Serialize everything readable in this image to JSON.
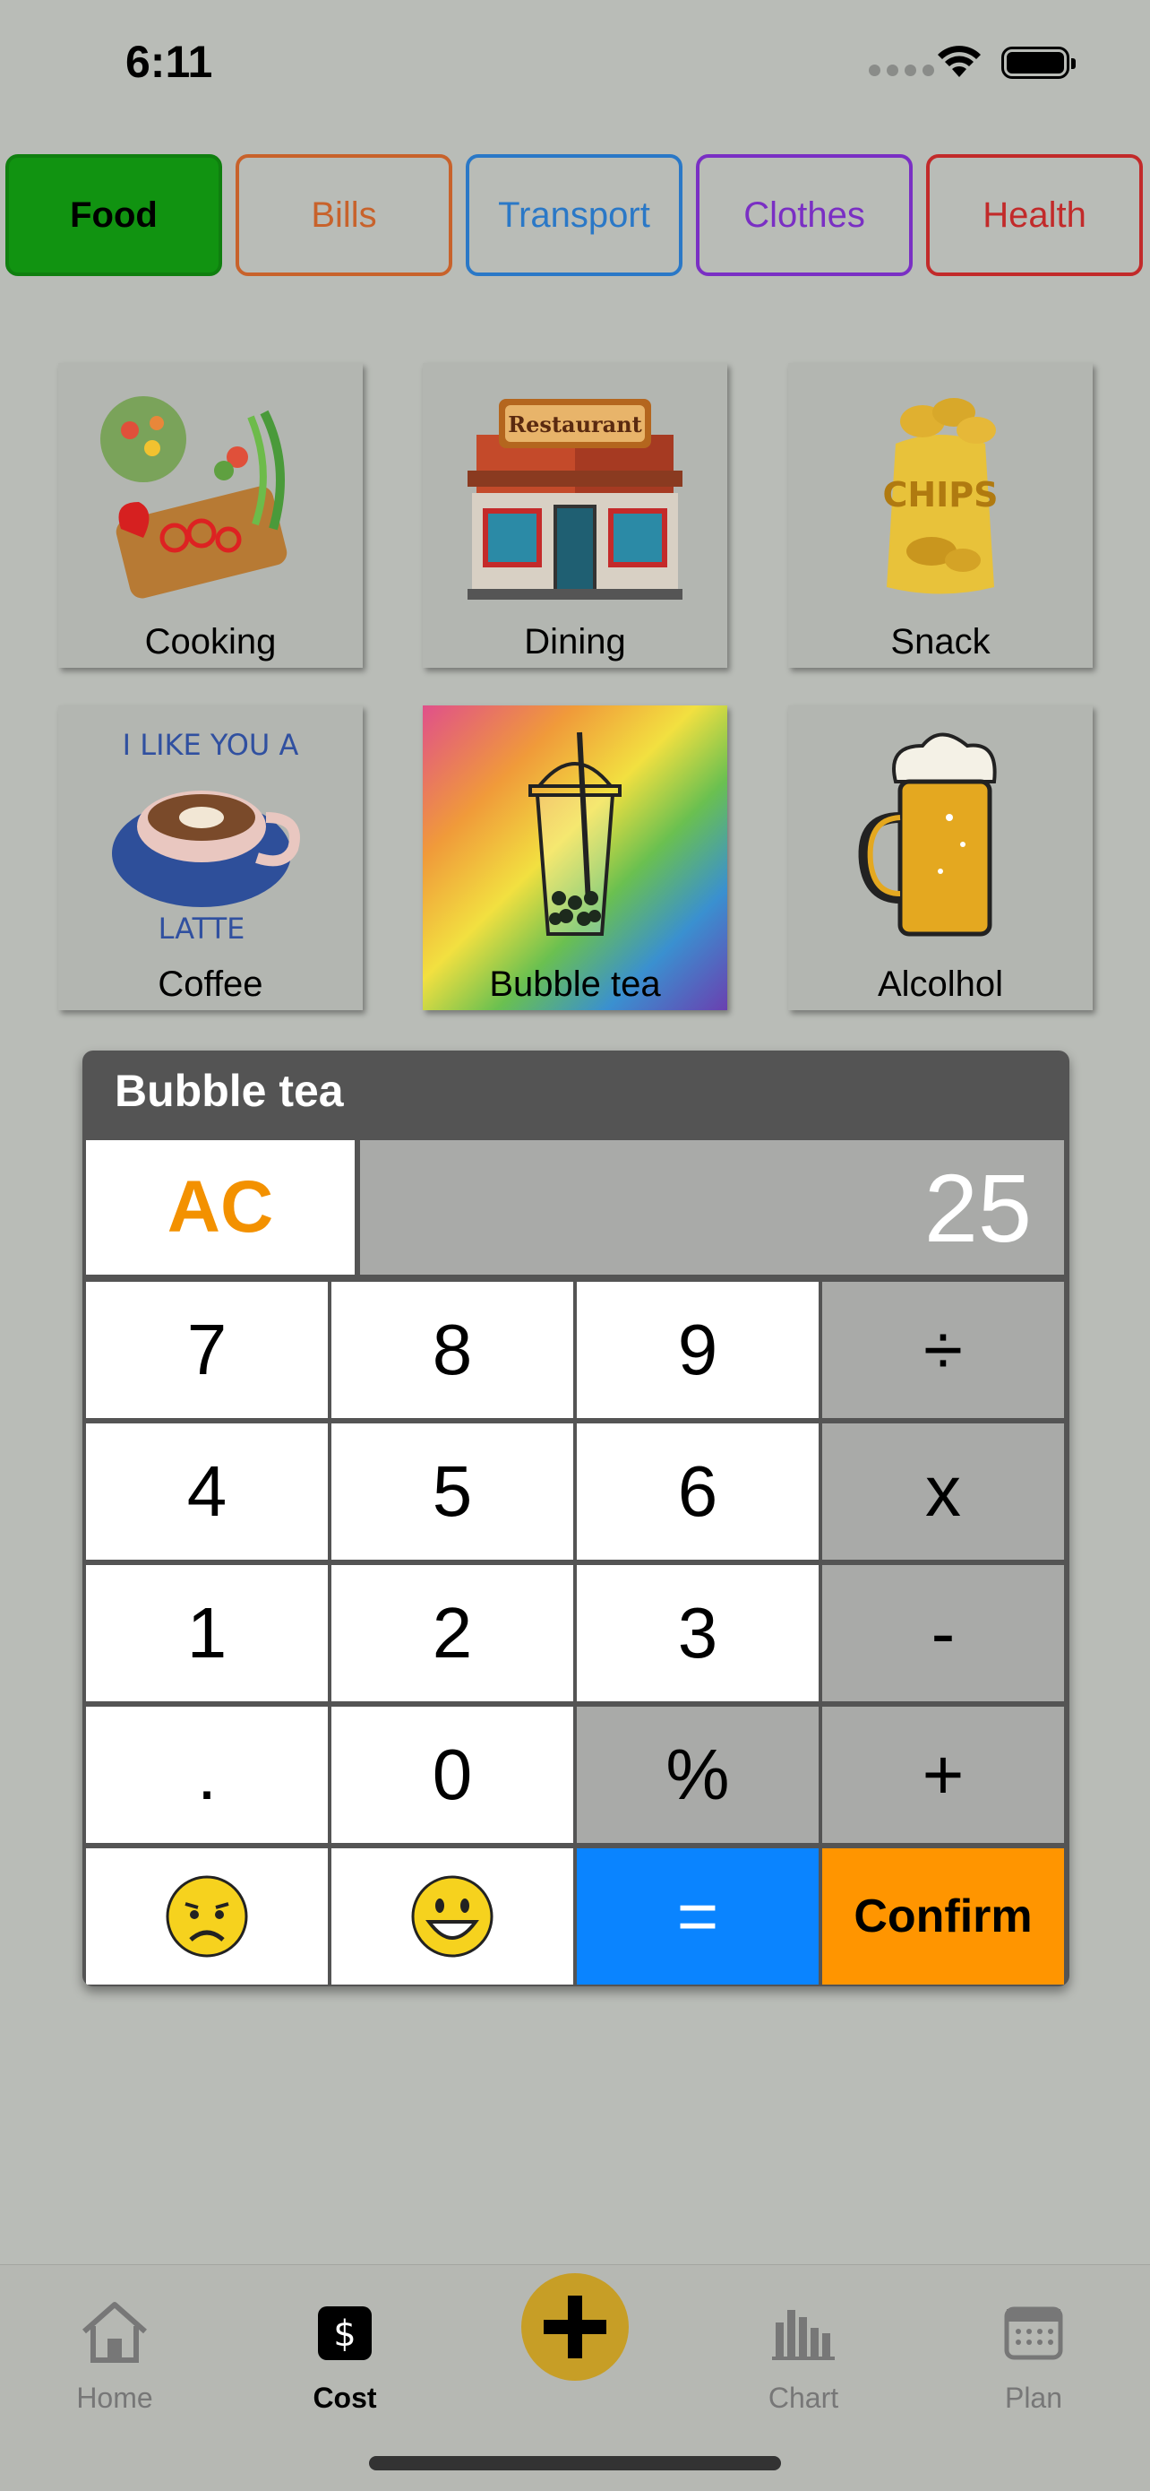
{
  "status_bar": {
    "time": "6:11"
  },
  "categories": [
    {
      "label": "Food",
      "color": "#0f7f0f",
      "active": true
    },
    {
      "label": "Bills",
      "color": "#c8622b",
      "active": false
    },
    {
      "label": "Transport",
      "color": "#2a78c7",
      "active": false
    },
    {
      "label": "Clothes",
      "color": "#7a2fc4",
      "active": false
    },
    {
      "label": "Health",
      "color": "#c22a2a",
      "active": false
    }
  ],
  "items": [
    {
      "label": "Cooking",
      "icon": "cooking-icon"
    },
    {
      "label": "Dining",
      "icon": "restaurant-icon"
    },
    {
      "label": "Snack",
      "icon": "chips-icon"
    },
    {
      "label": "Coffee",
      "icon": "latte-icon"
    },
    {
      "label": "Bubble tea",
      "icon": "bubble-tea-icon"
    },
    {
      "label": "Alcolhol",
      "icon": "beer-icon"
    }
  ],
  "calculator": {
    "title": "Bubble tea",
    "display": "25",
    "ac_label": "AC",
    "keys": [
      "7",
      "8",
      "9",
      "÷",
      "4",
      "5",
      "6",
      "x",
      "1",
      "2",
      "3",
      "-",
      ".",
      "0",
      "%",
      "+"
    ],
    "sad_icon": "frowning-face-icon",
    "happy_icon": "smiling-face-icon",
    "equals_label": "=",
    "confirm_label": "Confirm"
  },
  "tab_bar": {
    "home": "Home",
    "cost": "Cost",
    "chart": "Chart",
    "plan": "Plan"
  }
}
